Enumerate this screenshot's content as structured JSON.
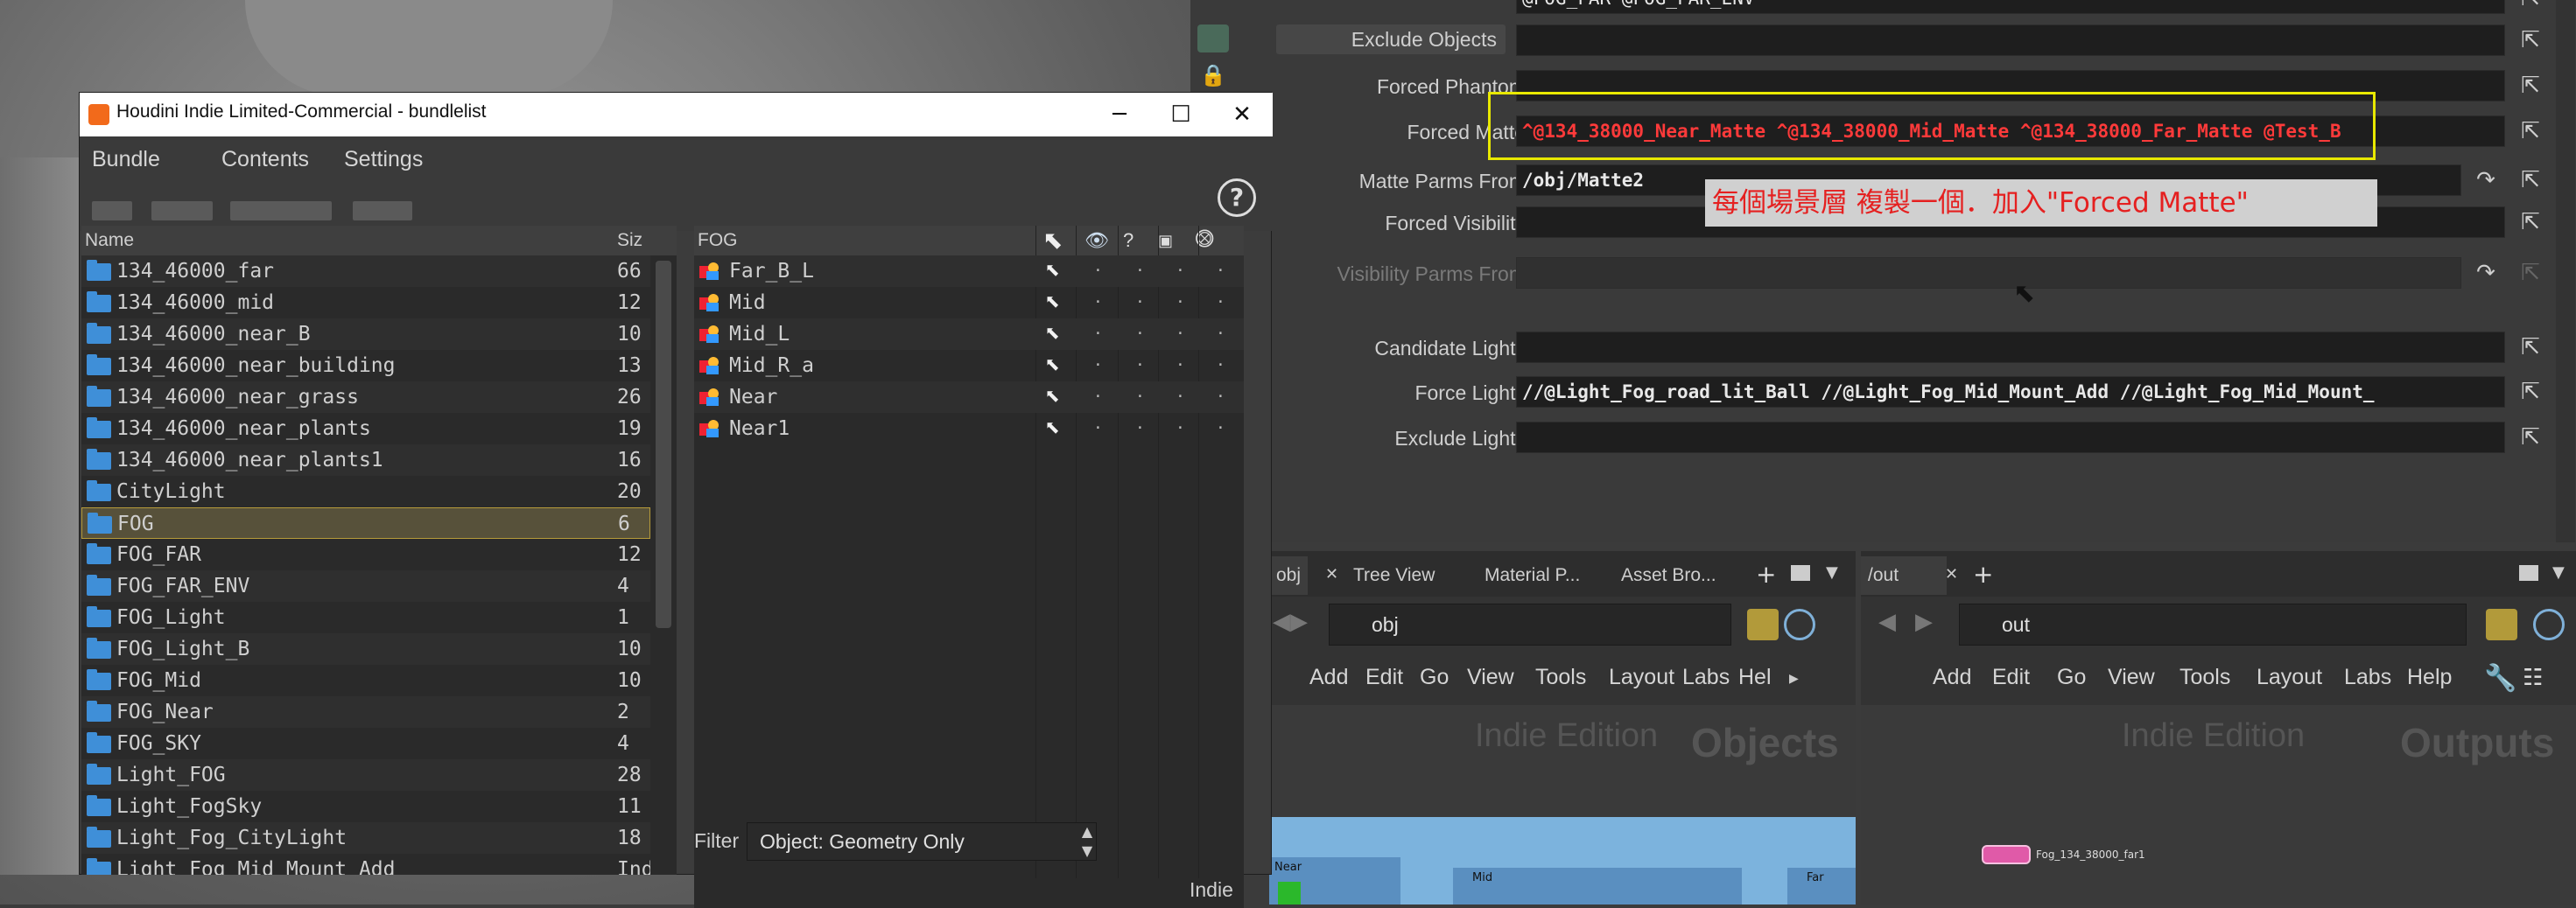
{
  "window": {
    "title": "Houdini Indie Limited-Commercial - bundlelist",
    "minimize": "─",
    "maximize": "☐",
    "close": "✕",
    "menu": [
      "Bundle",
      "Contents",
      "Settings"
    ],
    "help": "?"
  },
  "bundles": {
    "header_name": "Name",
    "header_size": "Siz",
    "items": [
      {
        "name": "134_46000_far",
        "size": "66"
      },
      {
        "name": "134_46000_mid",
        "size": "12"
      },
      {
        "name": "134_46000_near_B",
        "size": "10"
      },
      {
        "name": "134_46000_near_building",
        "size": "13"
      },
      {
        "name": "134_46000_near_grass",
        "size": "26"
      },
      {
        "name": "134_46000_near_plants",
        "size": "19"
      },
      {
        "name": "134_46000_near_plants1",
        "size": "16"
      },
      {
        "name": "CityLight",
        "size": "20"
      },
      {
        "name": "FOG",
        "size": "6"
      },
      {
        "name": "FOG_FAR",
        "size": "12"
      },
      {
        "name": "FOG_FAR_ENV",
        "size": "4"
      },
      {
        "name": "FOG_Light",
        "size": "1"
      },
      {
        "name": "FOG_Light_B",
        "size": "10"
      },
      {
        "name": "FOG_Mid",
        "size": "10"
      },
      {
        "name": "FOG_Near",
        "size": "2"
      },
      {
        "name": "FOG_SKY",
        "size": "4"
      },
      {
        "name": "Light_FOG",
        "size": "28"
      },
      {
        "name": "Light_FogSky",
        "size": "11"
      },
      {
        "name": "Light_Fog_CityLight",
        "size": "18"
      },
      {
        "name": "Light_Fog_Mid_Mount_Add",
        "size": "Indie"
      }
    ],
    "selected": "FOG"
  },
  "contents": {
    "header": "FOG",
    "items": [
      "Far_B_L",
      "Mid",
      "Mid_L",
      "Mid_R_a",
      "Near",
      "Near1"
    ],
    "dot": "·",
    "watermark": "Indie",
    "filter_label": "Filter",
    "filter_value": "Object: Geometry Only"
  },
  "params": {
    "exclude_objects": "Exclude Objects",
    "forced_phantom": "Forced Phantom",
    "forced_matte": "Forced Matte",
    "forced_matte_value": "^@134_38000_Near_Matte  ^@134_38000_Mid_Matte  ^@134_38000_Far_Matte  @Test_B",
    "matte_parms_from": "Matte Parms From",
    "matte_parms_value": "/obj/Matte2",
    "forced_visibility": "Forced Visibility",
    "visibility_parms_from": "Visibility Parms From",
    "candidate_lights": "Candidate Lights",
    "force_lights": "Force Lights",
    "force_lights_value": "//@Light_Fog_road_lit_Ball  //@Light_Fog_Mid_Mount_Add  //@Light_Fog_Mid_Mount_",
    "exclude_lights": "Exclude Lights",
    "top_value": "@FOG_FAR @FOG_FAR_ENV",
    "annotation": "每個場景層  複製一個．加入\"Forced Matte\""
  },
  "pane_left": {
    "tabs": [
      "obj",
      "Tree View",
      "Material P...",
      "Asset Bro..."
    ],
    "path": "obj",
    "menu": [
      "Add",
      "Edit",
      "Go",
      "View",
      "Tools",
      "Layout",
      "Labs",
      "Hel"
    ],
    "watermark1": "Indie Edition",
    "watermark2": "Objects",
    "nodes": [
      "Near",
      "Mid",
      "Far"
    ]
  },
  "pane_right": {
    "tab": "/out",
    "path": "out",
    "menu": [
      "Add",
      "Edit",
      "Go",
      "View",
      "Tools",
      "Layout",
      "Labs",
      "Help"
    ],
    "watermark1": "Indie Edition",
    "watermark2": "Outputs",
    "node_name": "Fog_134_38000_far1"
  },
  "colors": {
    "accent_selected": "#57513a",
    "highlight_box": "#e8e800",
    "matte_text": "#ff3a3a",
    "annotation_text": "#e52020",
    "folder": "#3f8fd8"
  }
}
